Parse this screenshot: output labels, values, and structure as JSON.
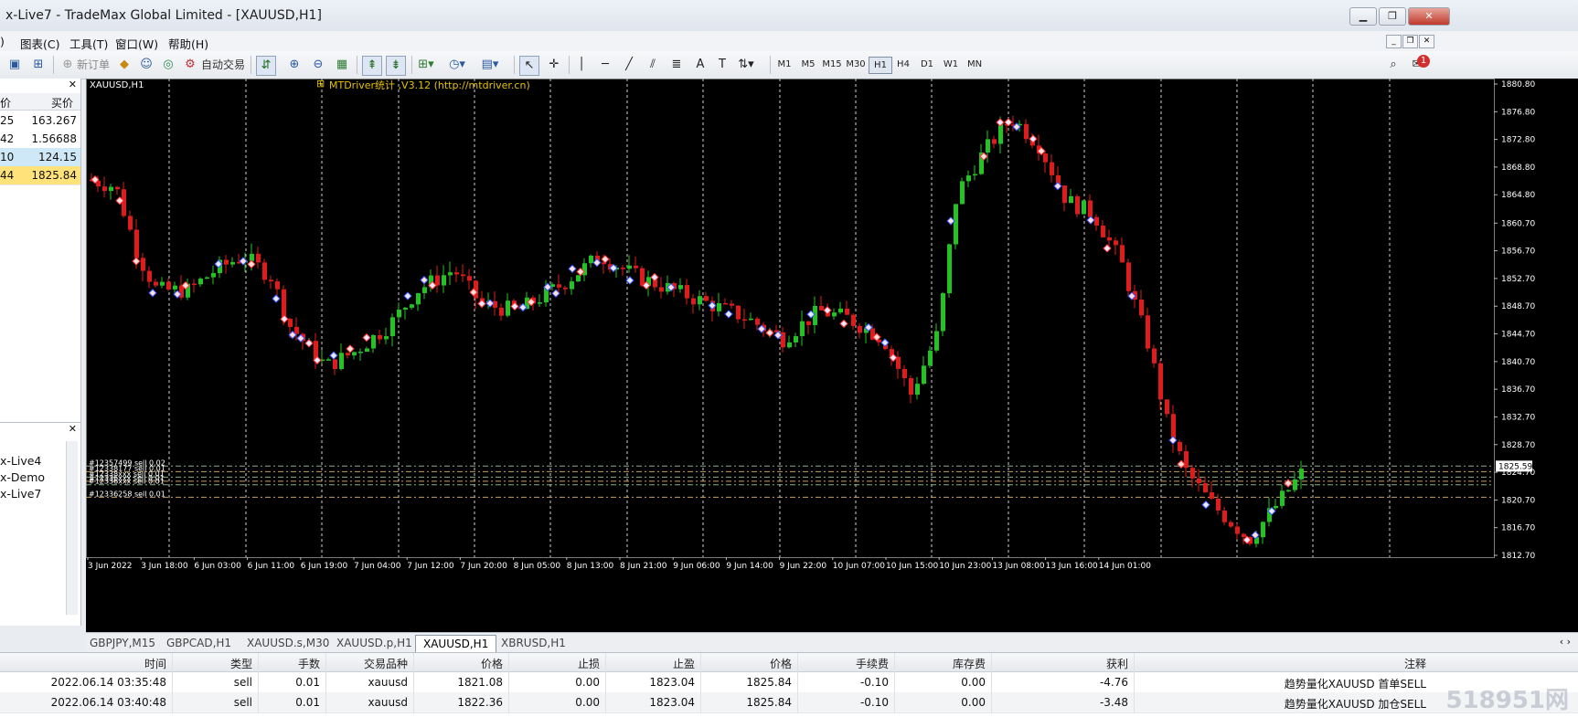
{
  "window": {
    "title": "x-Live7 - TradeMax Global Limited - [XAUUSD,H1]"
  },
  "menu": [
    "图表(C)",
    "工具(T)",
    "窗口(W)",
    "帮助(H)"
  ],
  "toolbar": {
    "new_order": "新订单",
    "auto_trade": "自动交易",
    "timeframes": [
      "M1",
      "M5",
      "M15",
      "M30",
      "H1",
      "H4",
      "D1",
      "W1",
      "MN"
    ],
    "active_timeframe": "H1",
    "alert_count": "1"
  },
  "market_watch": {
    "header_left": "价",
    "header_right": "买价",
    "rows": [
      {
        "left": "25",
        "right": "163.267",
        "bg": "#ffffff"
      },
      {
        "left": "42",
        "right": "1.56688",
        "bg": "#ffffff"
      },
      {
        "left": "10",
        "right": "124.15",
        "bg": "#cfe8f7"
      },
      {
        "left": "44",
        "right": "1825.84",
        "bg": "#ffe27a"
      }
    ]
  },
  "navigator": {
    "items": [
      "x-Live4",
      "x-Demo",
      "x-Live7"
    ]
  },
  "chart": {
    "symbol_label": "XAUUSD,H1",
    "indicator_label": "MTDriver统计 ,V3.12 (http://mtdriver.cn)",
    "current_price": "1825.59",
    "y_ticks": [
      "1880.80",
      "1876.80",
      "1872.80",
      "1868.80",
      "1864.80",
      "1860.70",
      "1856.70",
      "1852.70",
      "1848.70",
      "1844.70",
      "1840.70",
      "1836.70",
      "1832.70",
      "1828.70",
      "1824.70",
      "1820.70",
      "1816.70",
      "1812.70"
    ],
    "x_ticks": [
      "3 Jun 2022",
      "3 Jun 18:00",
      "6 Jun 03:00",
      "6 Jun 11:00",
      "6 Jun 19:00",
      "7 Jun 04:00",
      "7 Jun 12:00",
      "7 Jun 20:00",
      "8 Jun 05:00",
      "8 Jun 13:00",
      "8 Jun 21:00",
      "9 Jun 06:00",
      "9 Jun 14:00",
      "9 Jun 22:00",
      "10 Jun 07:00",
      "10 Jun 15:00",
      "10 Jun 23:00",
      "13 Jun 08:00",
      "13 Jun 16:00",
      "14 Jun 01:00"
    ],
    "order_lines": [
      {
        "label": "#12357499 sell 0.02",
        "price": 1825.6
      },
      {
        "label": "#12338177 sell 0.01",
        "price": 1824.8
      },
      {
        "label": "#12338xxx sell 0.01",
        "price": 1824.0
      },
      {
        "label": "#12336xxx sell 0.01",
        "price": 1823.4
      },
      {
        "label": "#12336xxx sell 0.01",
        "price": 1822.9
      },
      {
        "label": "#12336258 sell 0.01",
        "price": 1821.1
      }
    ],
    "colors": {
      "bull": "#22c322",
      "bear": "#e01b1b",
      "grid": "#8a8a8a"
    }
  },
  "chart_tabs": [
    {
      "label": "GBPJPY,M15",
      "active": false
    },
    {
      "label": "GBPCAD,H1",
      "active": false
    },
    {
      "label": "XAUUSD.s,M30",
      "active": false
    },
    {
      "label": "XAUUSD.p,H1",
      "active": false
    },
    {
      "label": "XAUUSD,H1",
      "active": true
    },
    {
      "label": "XBRUSD,H1",
      "active": false
    }
  ],
  "terminal": {
    "headers": [
      "时间",
      "类型",
      "手数",
      "交易品种",
      "价格",
      "止损",
      "止盈",
      "价格",
      "手续费",
      "库存费",
      "获利",
      "注释"
    ],
    "rows": [
      [
        "2022.06.14 03:35:48",
        "sell",
        "0.01",
        "xauusd",
        "1821.08",
        "0.00",
        "1823.04",
        "1825.84",
        "-0.10",
        "0.00",
        "-4.76",
        "趋势量化XAUUSD 首单SELL"
      ],
      [
        "2022.06.14 03:40:48",
        "sell",
        "0.01",
        "xauusd",
        "1822.36",
        "0.00",
        "1823.04",
        "1825.84",
        "-0.10",
        "0.00",
        "-3.48",
        "趋势量化XAUUSD 加仓SELL"
      ]
    ]
  },
  "watermark": "518951网"
}
